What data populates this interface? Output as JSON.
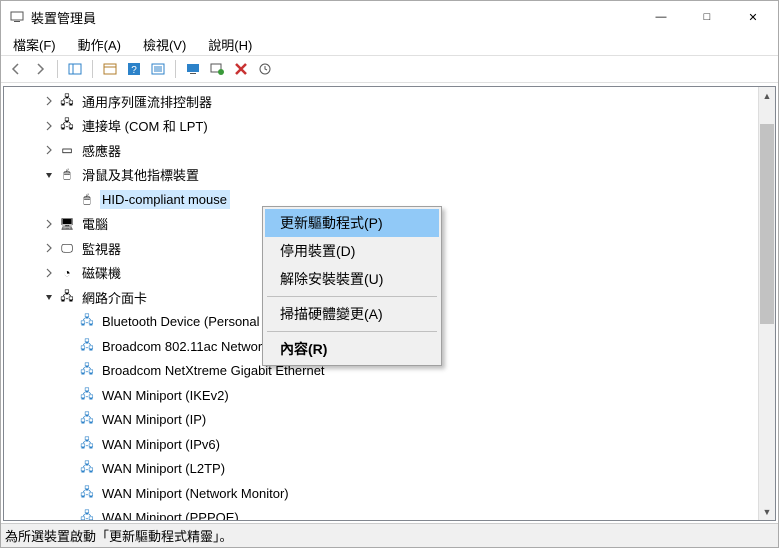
{
  "window": {
    "title": "裝置管理員"
  },
  "menu": {
    "file": "檔案(F)",
    "action": "動作(A)",
    "view": "檢視(V)",
    "help": "說明(H)"
  },
  "toolbar_icons": {
    "back": "back-icon",
    "forward": "forward-icon",
    "up": "show-hidden-icon",
    "properties": "properties-icon",
    "help": "help-icon",
    "options": "options-icon",
    "monitor": "monitor-icon",
    "scan": "scan-icon",
    "remove": "remove-icon",
    "update": "update-icon"
  },
  "tree": {
    "rows": [
      {
        "indent": 2,
        "expander": ">",
        "icon": "🖧",
        "label": "通用序列匯流排控制器"
      },
      {
        "indent": 2,
        "expander": ">",
        "icon": "🖧",
        "label": "連接埠 (COM 和 LPT)"
      },
      {
        "indent": 2,
        "expander": ">",
        "icon": "▭",
        "label": "感應器"
      },
      {
        "indent": 2,
        "expander": "v",
        "icon": "🖱",
        "label": "滑鼠及其他指標裝置"
      },
      {
        "indent": 3,
        "expander": "",
        "icon": "🖱",
        "label": "HID-compliant mouse",
        "selected": true
      },
      {
        "indent": 2,
        "expander": ">",
        "icon": "🖥",
        "label": "電腦"
      },
      {
        "indent": 2,
        "expander": ">",
        "icon": "🖵",
        "label": "監視器"
      },
      {
        "indent": 2,
        "expander": ">",
        "icon": "◔",
        "label": "磁碟機"
      },
      {
        "indent": 2,
        "expander": "v",
        "icon": "🖧",
        "label": "網路介面卡"
      },
      {
        "indent": 3,
        "expander": "",
        "icon": "🖧",
        "label": "Bluetooth Device (Personal Area Network)",
        "net": true
      },
      {
        "indent": 3,
        "expander": "",
        "icon": "🖧",
        "label": "Broadcom 802.11ac Network Adapter",
        "net": true
      },
      {
        "indent": 3,
        "expander": "",
        "icon": "🖧",
        "label": "Broadcom NetXtreme Gigabit Ethernet",
        "net": true
      },
      {
        "indent": 3,
        "expander": "",
        "icon": "🖧",
        "label": "WAN Miniport (IKEv2)",
        "net": true
      },
      {
        "indent": 3,
        "expander": "",
        "icon": "🖧",
        "label": "WAN Miniport (IP)",
        "net": true
      },
      {
        "indent": 3,
        "expander": "",
        "icon": "🖧",
        "label": "WAN Miniport (IPv6)",
        "net": true
      },
      {
        "indent": 3,
        "expander": "",
        "icon": "🖧",
        "label": "WAN Miniport (L2TP)",
        "net": true
      },
      {
        "indent": 3,
        "expander": "",
        "icon": "🖧",
        "label": "WAN Miniport (Network Monitor)",
        "net": true
      },
      {
        "indent": 3,
        "expander": "",
        "icon": "🖧",
        "label": "WAN Miniport (PPPOE)",
        "net": true
      }
    ]
  },
  "context_menu": {
    "update": "更新驅動程式(P)",
    "disable": "停用裝置(D)",
    "uninstall": "解除安裝裝置(U)",
    "scan": "掃描硬體變更(A)",
    "properties": "內容(R)"
  },
  "status": {
    "text": "為所選裝置啟動「更新驅動程式精靈」。"
  }
}
